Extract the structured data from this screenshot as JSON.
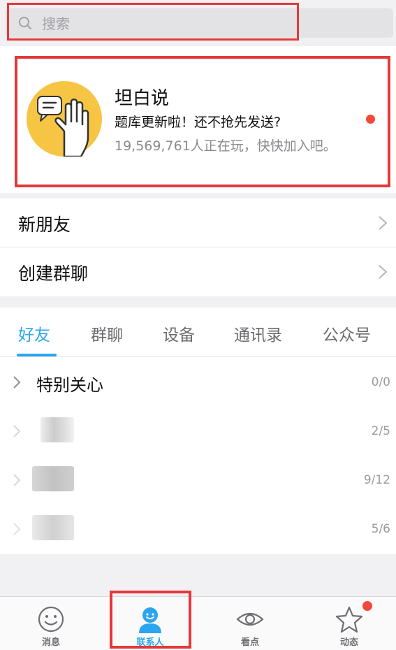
{
  "search": {
    "placeholder": "搜索"
  },
  "promo": {
    "title": "坦白说",
    "subtitle": "题库更新啦！还不抢先发送?",
    "players": "19,569,761人正在玩，快快加入吧。",
    "avatar_icon": "raised-hand-speech-bubble-icon",
    "unread_dot": true
  },
  "menu": [
    {
      "label": "新朋友"
    },
    {
      "label": "创建群聊"
    }
  ],
  "tabs": [
    "好友",
    "群聊",
    "设备",
    "通讯录",
    "公众号"
  ],
  "active_tab": "好友",
  "friend_groups": [
    {
      "name": "特别关心",
      "count": "0/0",
      "blurred": false
    },
    {
      "name": "",
      "count": "2/5",
      "blurred": true
    },
    {
      "name": "",
      "count": "9/12",
      "blurred": true
    },
    {
      "name": "",
      "count": "5/6",
      "blurred": true
    }
  ],
  "bottom_tabs": [
    {
      "label": "消息",
      "icon": "smiley-face-icon",
      "active": false
    },
    {
      "label": "联系人",
      "icon": "contact-person-icon",
      "active": true
    },
    {
      "label": "看点",
      "icon": "eye-icon",
      "active": false
    },
    {
      "label": "动态",
      "icon": "star-icon",
      "active": false,
      "badge": true
    }
  ],
  "colors": {
    "accent": "#2ba6ee",
    "highlight_outline": "#e4383a",
    "badge": "#f24a3a"
  }
}
